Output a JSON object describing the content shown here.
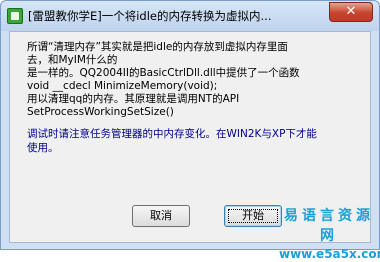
{
  "window": {
    "title": "[雷盟教你学E]一个将idle的内存转换为虚拟内...",
    "close_glyph": "✕",
    "icon": "app-icon"
  },
  "body": {
    "lines": [
      "所谓“清理内存”其实就是把idle的内存放到虚拟内存里面",
      "去，和MyIM什么的",
      "是一样的。QQ2004II的BasicCtrlDll.dll中提供了一个函数",
      "void __cdecl MinimizeMemory(void);",
      "用以清理qq的内存。其原理就是调用NT的API",
      "SetProcessWorkingSetSize()"
    ],
    "note_lines": [
      "调试时请注意任务管理器的中内存变化。在WIN2K与XP下才能",
      "使用。"
    ]
  },
  "buttons": {
    "cancel_label": "取消",
    "start_label": "开始"
  },
  "watermark": {
    "text": "易语言资源网",
    "url": "www.e5a5x.com"
  },
  "colors": {
    "note_text": "#00008b",
    "watermark": "#1aa0d8",
    "close_button": "#c8442c"
  }
}
